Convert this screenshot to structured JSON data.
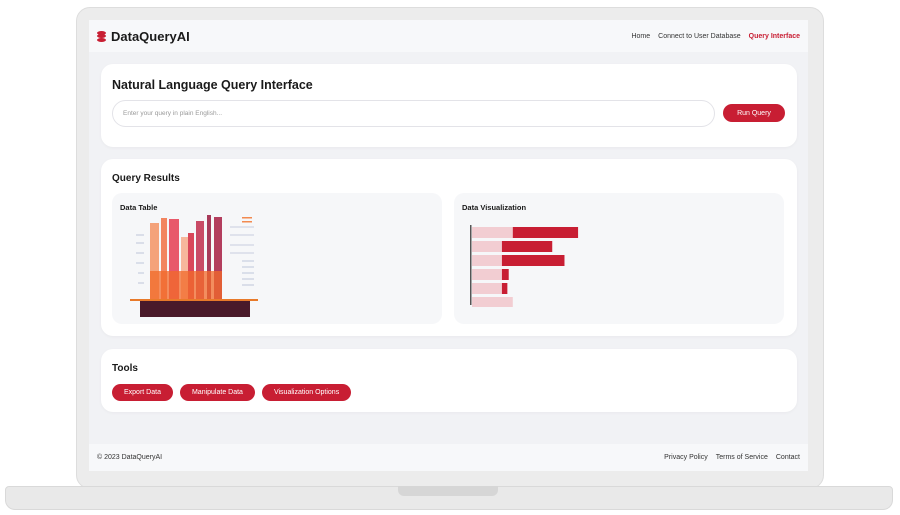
{
  "brand": {
    "name": "DataQueryAI",
    "icon": "database-icon",
    "color": "#c81e33"
  },
  "nav": {
    "items": [
      {
        "label": "Home",
        "active": false
      },
      {
        "label": "Connect to User Database",
        "active": false
      },
      {
        "label": "Query Interface",
        "active": true
      }
    ]
  },
  "query": {
    "title": "Natural Language Query Interface",
    "placeholder": "Enter your query in plain English...",
    "value": "",
    "run_label": "Run Query"
  },
  "results": {
    "title": "Query Results",
    "table_title": "Data Table",
    "viz_title": "Data Visualization"
  },
  "chart_data": {
    "type": "bar",
    "orientation": "horizontal",
    "series": [
      {
        "values": [
          0.48,
          0.37,
          0.46,
          0.05,
          0.04,
          0.0
        ]
      },
      {
        "values": [
          0.3,
          0.22,
          0.22,
          0.22,
          0.22,
          0.3
        ]
      }
    ],
    "colors": [
      "#c81e33",
      "#f2cdd2"
    ]
  },
  "tools": {
    "title": "Tools",
    "buttons": [
      "Export Data",
      "Manipulate Data",
      "Visualization Options"
    ]
  },
  "footer": {
    "copyright": "© 2023 DataQueryAI",
    "links": [
      "Privacy Policy",
      "Terms of Service",
      "Contact"
    ]
  },
  "colors": {
    "accent": "#c81e33",
    "background": "#f1f2f5",
    "panel": "#f6f7f9"
  }
}
